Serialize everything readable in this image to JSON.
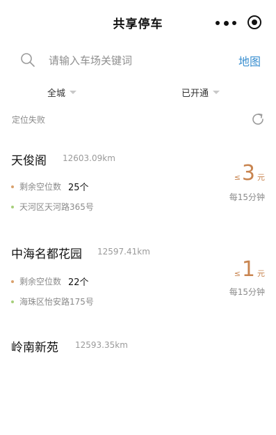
{
  "header": {
    "title": "共享停车",
    "more_icon": "more-dots-icon",
    "target_icon": "target-icon"
  },
  "search": {
    "placeholder": "请输入车场关键词",
    "value": "",
    "map_label": "地图"
  },
  "filters": [
    {
      "label": "全城"
    },
    {
      "label": "已开通"
    }
  ],
  "location": {
    "status": "定位失败"
  },
  "lots": [
    {
      "name": "天俊阁",
      "distance": "12603.09km",
      "free_label": "剩余空位数",
      "free_count": "25个",
      "address": "天河区天河路365号",
      "price_prefix": "≤",
      "price": "3",
      "price_unit": "元",
      "price_per": "每15分钟"
    },
    {
      "name": "中海名都花园",
      "distance": "12597.41km",
      "free_label": "剩余空位数",
      "free_count": "22个",
      "address": "海珠区怡安路175号",
      "price_prefix": "≤",
      "price": "1",
      "price_unit": "元",
      "price_per": "每15分钟"
    },
    {
      "name": "岭南新苑",
      "distance": "12593.35km"
    }
  ],
  "colors": {
    "accent_link": "#3a8fd0",
    "price": "#c8844f",
    "dot_orange": "#d9a16c",
    "dot_green": "#a6cf7a"
  }
}
